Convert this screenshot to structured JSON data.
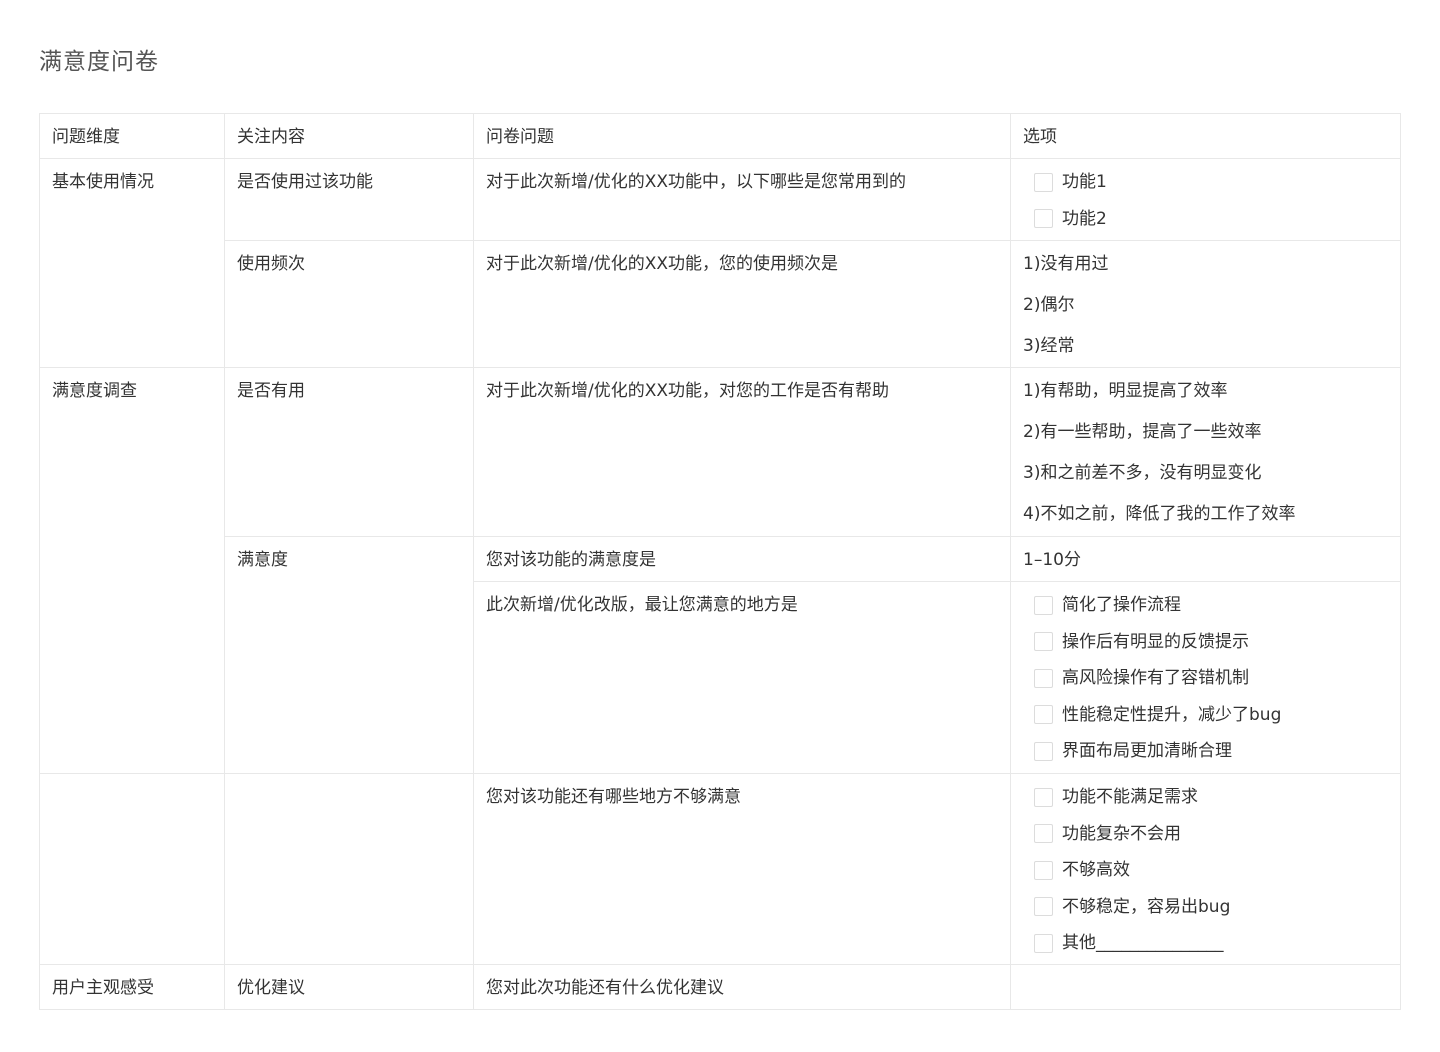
{
  "title": "满意度问卷",
  "headers": [
    "问题维度",
    "关注内容",
    "问卷问题",
    "选项"
  ],
  "rows": [
    {
      "dimension": "基本使用情况",
      "focus": "是否使用过该功能",
      "question": "对于此次新增/优化的XX功能中，以下哪些是您常用到的",
      "checkbox_options": [
        "功能1",
        "功能2"
      ]
    },
    {
      "focus": "使用频次",
      "question": "对于此次新增/优化的XX功能，您的使用频次是",
      "text_options": [
        "1)没有用过",
        "2)偶尔",
        "3)经常"
      ]
    },
    {
      "dimension": "满意度调查",
      "focus": "是否有用",
      "question": "对于此次新增/优化的XX功能，对您的工作是否有帮助",
      "text_options": [
        "1)有帮助，明显提高了效率",
        "2)有一些帮助，提高了一些效率",
        "3)和之前差不多，没有明显变化",
        "4)不如之前，降低了我的工作了效率"
      ]
    },
    {
      "focus": "满意度",
      "question": "您对该功能的满意度是",
      "text_options": [
        "1–10分"
      ]
    },
    {
      "question": "此次新增/优化改版，最让您满意的地方是",
      "checkbox_options": [
        "简化了操作流程",
        "操作后有明显的反馈提示",
        "高风险操作有了容错机制",
        "性能稳定性提升，减少了bug",
        "界面布局更加清晰合理"
      ]
    },
    {
      "question": "您对该功能还有哪些地方不够满意",
      "checkbox_options": [
        "功能不能满足需求",
        "功能复杂不会用",
        "不够高效",
        "不够稳定，容易出bug",
        "其他_______________"
      ]
    },
    {
      "dimension": "用户主观感受",
      "focus": "优化建议",
      "question": "您对此次功能还有什么优化建议"
    }
  ]
}
